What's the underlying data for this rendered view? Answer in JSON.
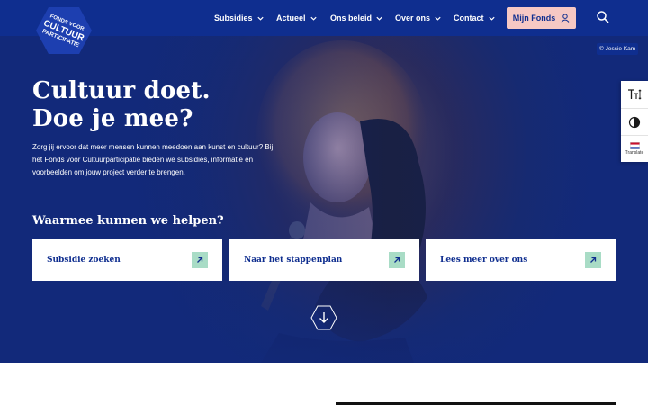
{
  "header": {
    "logo_text": "FONDS VOOR CULTUUR PARTICIPATIE",
    "nav": [
      {
        "label": "Subsidies",
        "icon": "chevron-down-icon"
      },
      {
        "label": "Actueel",
        "icon": "chevron-down-icon"
      },
      {
        "label": "Ons beleid",
        "icon": "chevron-down-icon"
      },
      {
        "label": "Over ons",
        "icon": "chevron-down-icon"
      },
      {
        "label": "Contact",
        "icon": "chevron-down-icon"
      }
    ],
    "account_button": {
      "label": "Mijn Fonds",
      "icon": "user-icon"
    },
    "search_icon": "search-icon"
  },
  "hero": {
    "photo_credit": "© Jessie Kam",
    "headline_line1": "Cultuur doet.",
    "headline_line2": "Doe je mee?",
    "intro": "Zorg jij ervoor dat meer mensen kunnen meedoen aan kunst en cultuur? Bij het Fonds voor Cultuurparticipatie bieden we subsidies, informatie en voorbeelden om jouw project verder te brengen.",
    "help_title": "Waarmee kunnen we helpen?",
    "cards": [
      {
        "label": "Subsidie zoeken",
        "icon": "arrow-up-right-icon"
      },
      {
        "label": "Naar het stappenplan",
        "icon": "arrow-up-right-icon"
      },
      {
        "label": "Lees meer over ons",
        "icon": "arrow-up-right-icon"
      }
    ],
    "scroll_icon": "arrow-down-icon"
  },
  "side_tools": {
    "items": [
      {
        "icon": "text-size-icon"
      },
      {
        "icon": "contrast-icon"
      },
      {
        "icon": "dutch-flag-icon",
        "label": "Translate"
      }
    ]
  },
  "colors": {
    "brand_blue": "#0f2e8f",
    "account_pink": "#f6c8c4",
    "arrow_green": "#a9dcc6"
  }
}
